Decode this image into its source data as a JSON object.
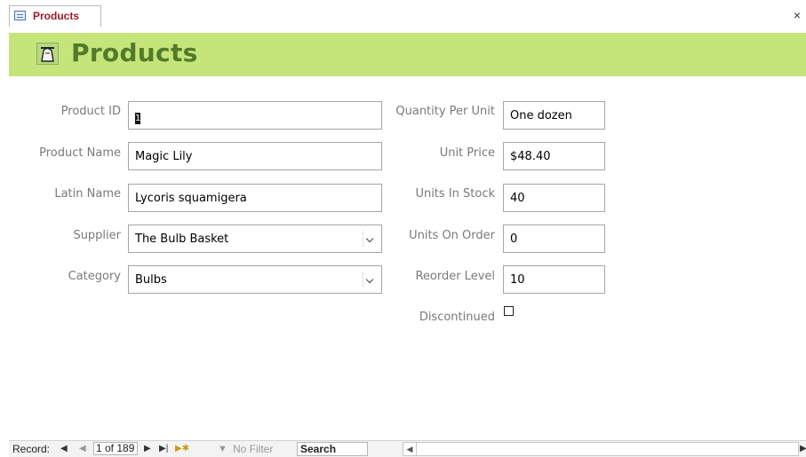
{
  "tab": {
    "label": "Products",
    "close": "×"
  },
  "header": {
    "title": "Products"
  },
  "left_fields": [
    {
      "label": "Product ID",
      "value": ""
    },
    {
      "label": "Product Name",
      "value": "Magic Lily"
    },
    {
      "label": "Latin Name",
      "value": "Lycoris squamigera"
    },
    {
      "label": "Supplier",
      "value": "The Bulb Basket"
    },
    {
      "label": "Category",
      "value": "Bulbs"
    }
  ],
  "right_fields": [
    {
      "label": "Quantity Per Unit",
      "value": "One dozen"
    },
    {
      "label": "Unit Price",
      "value": "$48.40"
    },
    {
      "label": "Units In Stock",
      "value": "40"
    },
    {
      "label": "Units On Order",
      "value": "0"
    },
    {
      "label": "Reorder Level",
      "value": "10"
    }
  ],
  "product_id_value": "1",
  "discontinued": {
    "label": "Discontinued",
    "checked": false
  },
  "navigation": {
    "record_label": "Record:",
    "record_position": "1 of 189",
    "no_filter": "No Filter",
    "search": "Search"
  },
  "colors": {
    "header_band": "#c5e57a",
    "title": "#527a2a",
    "tab_label": "#a0182a"
  }
}
